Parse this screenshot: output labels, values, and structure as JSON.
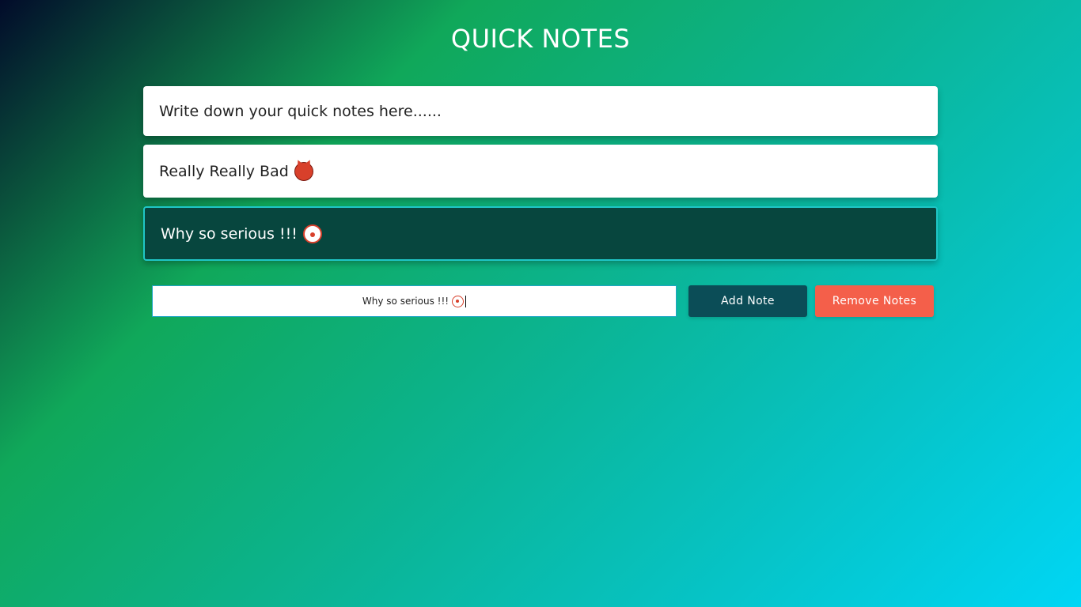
{
  "header": {
    "title": "QUICK NOTES"
  },
  "notes": [
    {
      "text": "Write down your quick notes here......",
      "emoji": ""
    },
    {
      "text": "Really Really Bad",
      "emoji": "devil"
    },
    {
      "text": "Why so serious !!!",
      "emoji": "clown"
    }
  ],
  "composer": {
    "input_value": "Why so serious !!!",
    "input_emoji": "clown",
    "add_label": "Add Note",
    "remove_label": "Remove Notes"
  },
  "colors": {
    "selected_note_bg": "#07463e",
    "selected_note_border": "#1fc6c6",
    "add_button": "#0b4d57",
    "remove_button": "#f45f4a"
  }
}
